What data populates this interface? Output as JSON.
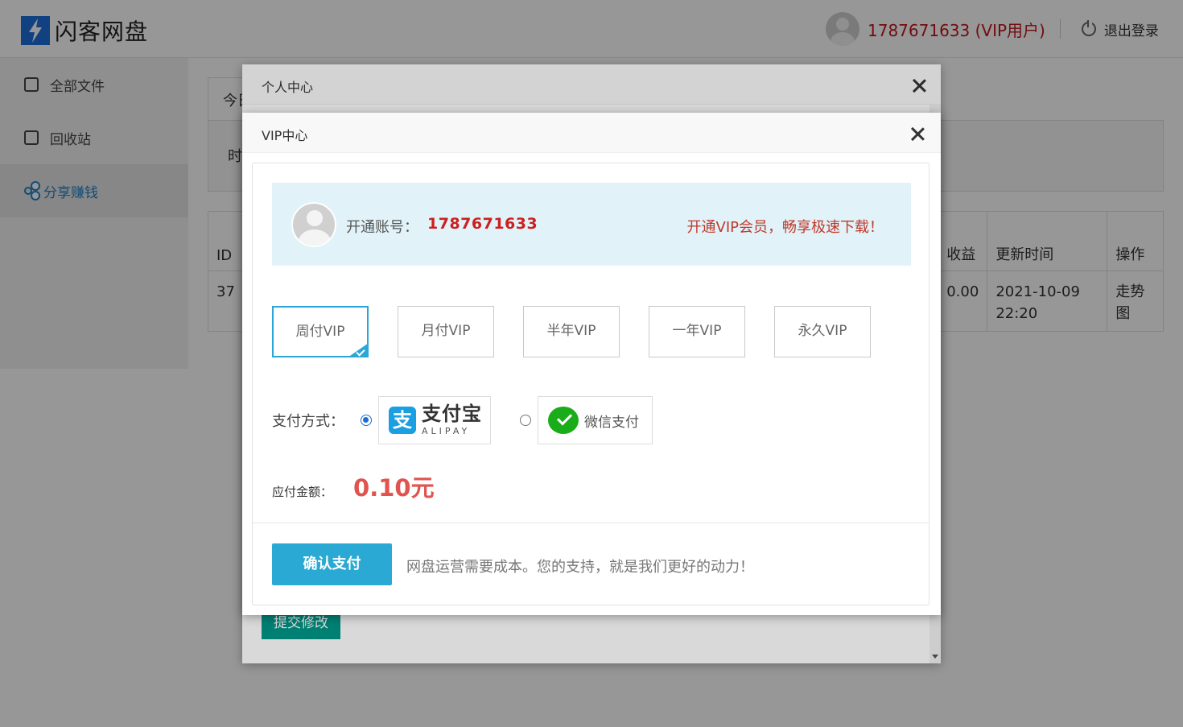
{
  "app": {
    "logo_text": "闪客网盘",
    "user_label": "1787671633 (VIP用户)",
    "logout_label": "退出登录"
  },
  "sidebar": {
    "items": [
      {
        "label": "全部文件",
        "icon": "files-icon"
      },
      {
        "label": "回收站",
        "icon": "trash-icon"
      },
      {
        "label": "分享赚钱",
        "icon": "share-icon",
        "active": true
      }
    ]
  },
  "background": {
    "tab_stub": "今日",
    "panel_stub": "时",
    "table": {
      "headers": [
        "ID",
        "收益",
        "更新时间",
        "操作"
      ],
      "row": {
        "id": "37",
        "income": "0.00",
        "updated": "2021-10-09 22:20",
        "action": "走势图"
      }
    },
    "submit_label": "提交修改"
  },
  "outer_modal": {
    "title": "个人中心"
  },
  "vip_modal": {
    "title": "VIP中心",
    "account_label": "开通账号：",
    "account_id": "1787671633",
    "slogan": "开通VIP会员，畅享极速下载！",
    "plans": [
      {
        "label": "周付VIP",
        "selected": true
      },
      {
        "label": "月付VIP",
        "selected": false
      },
      {
        "label": "半年VIP",
        "selected": false
      },
      {
        "label": "一年VIP",
        "selected": false
      },
      {
        "label": "永久VIP",
        "selected": false
      }
    ],
    "payment_label": "支付方式：",
    "payment_methods": [
      {
        "name": "支付宝",
        "en": "ALIPAY",
        "selected": true
      },
      {
        "name": "微信支付",
        "selected": false
      }
    ],
    "amount_label": "应付金额：",
    "amount_value": "0.10元",
    "confirm_label": "确认支付",
    "support_text": "网盘运营需要成本。您的支持，就是我们更好的动力！"
  },
  "colors": {
    "accent": "#2aa9d4",
    "price": "#e0534f",
    "account_id": "#cc1f1f",
    "slogan": "#c0392b",
    "user_label": "#c0161b",
    "submit": "#009688"
  }
}
